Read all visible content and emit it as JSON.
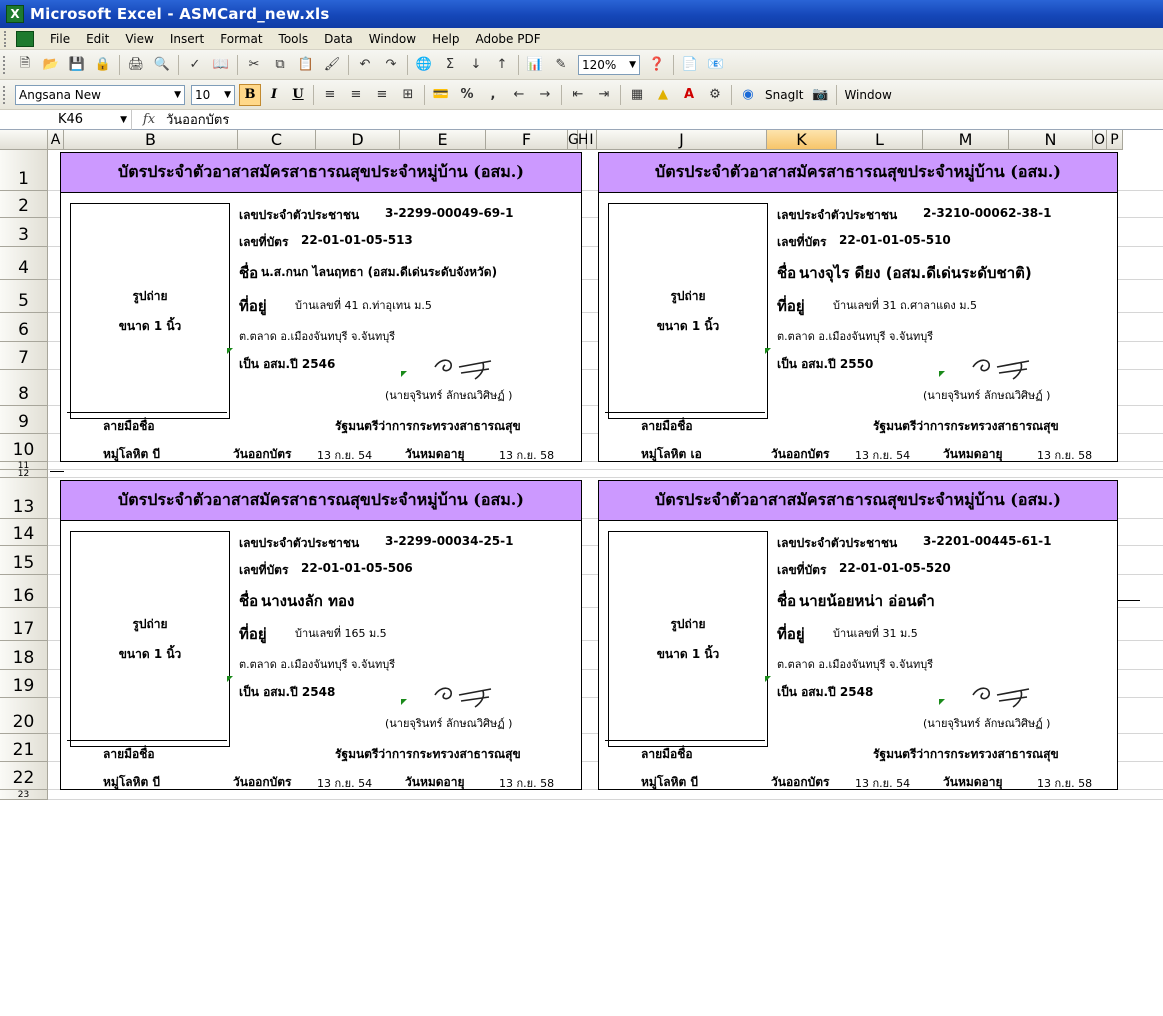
{
  "window": {
    "title": "Microsoft Excel - ASMCard_new.xls",
    "app_icon": "X"
  },
  "menu": [
    "File",
    "Edit",
    "View",
    "Insert",
    "Format",
    "Tools",
    "Data",
    "Window",
    "Help",
    "Adobe PDF"
  ],
  "toolbar": {
    "zoom": "120%",
    "font": "Angsana New",
    "size": "10",
    "bold": "B",
    "italic": "I",
    "underline": "U",
    "percent": "%",
    "comma": ",",
    "snagit": "SnagIt",
    "window_label": "Window"
  },
  "formula": {
    "cell": "K46",
    "fx": "fx",
    "value": "วันออกบัตร"
  },
  "columns": [
    "A",
    "B",
    "C",
    "D",
    "E",
    "F",
    "G",
    "H",
    "I",
    "J",
    "K",
    "L",
    "M",
    "N",
    "O",
    "P"
  ],
  "selected_column": "K",
  "rows": [
    "1",
    "2",
    "3",
    "4",
    "5",
    "6",
    "7",
    "8",
    "9",
    "10",
    "11",
    "12",
    "13",
    "14",
    "15",
    "16",
    "17",
    "18",
    "19",
    "20",
    "21",
    "22",
    "23"
  ],
  "card_common": {
    "title": "บัตรประจำตัวอาสาสมัครสาธารณสุขประจำหมู่บ้าน (อสม.)",
    "photo_line1": "รูปถ่าย",
    "photo_line2": "ขนาด 1 นิ้ว",
    "id_label": "เลขประจำตัวประชาชน",
    "card_no_label": "เลขที่บัตร",
    "name_label": "ชื่อ",
    "address_label": "ที่อยู่",
    "signer": "(นายจุรินทร์ ลักษณวิศิษฏ์ )",
    "signature_label": "ลายมือชื่อ",
    "minister": "รัฐมนตรีว่าการกระทรวงสาธารณสุข",
    "issue_label": "วันออกบัตร",
    "issue_date": "13 ก.ย. 54",
    "expire_label": "วันหมดอายุ",
    "expire_date": "13 ก.ย. 58"
  },
  "cards": [
    {
      "id": "3-2299-00049-69-1",
      "card_no": "22-01-01-05-513",
      "name": "น.ส.กนก ไลนฤทธา (อสม.ดีเด่นระดับจังหวัด)",
      "address": "บ้านเลขที่ 41 ถ.ท่าอุเทน ม.5",
      "address2": "ต.ตลาด อ.เมืองจันทบุรี จ.จันทบุรี",
      "year": "เป็น อสม.ปี 2546",
      "blood": "หมู่โลหิต  บี"
    },
    {
      "id": "2-3210-00062-38-1",
      "card_no": "22-01-01-05-510",
      "name": "นางจุไร ดียง (อสม.ดีเด่นระดับชาติ)",
      "address": "บ้านเลขที่ 31 ถ.ศาลาแดง ม.5",
      "address2": "ต.ตลาด อ.เมืองจันทบุรี จ.จันทบุรี",
      "year": "เป็น อสม.ปี 2550",
      "blood": "หมู่โลหิต  เอ"
    },
    {
      "id": "3-2299-00034-25-1",
      "card_no": "22-01-01-05-506",
      "name": "นางนงลัก ทอง",
      "address": "บ้านเลขที่ 165 ม.5",
      "address2": "ต.ตลาด อ.เมืองจันทบุรี จ.จันทบุรี",
      "year": "เป็น อสม.ปี 2548",
      "blood": "หมู่โลหิต  บี"
    },
    {
      "id": "3-2201-00445-61-1",
      "card_no": "22-01-01-05-520",
      "name": "นายน้อยหน่า อ่อนดำ",
      "address": "บ้านเลขที่ 31 ม.5",
      "address2": "ต.ตลาด อ.เมืองจันทบุรี จ.จันทบุรี",
      "year": "เป็น อสม.ปี 2548",
      "blood": "หมู่โลหิต  บี"
    }
  ]
}
